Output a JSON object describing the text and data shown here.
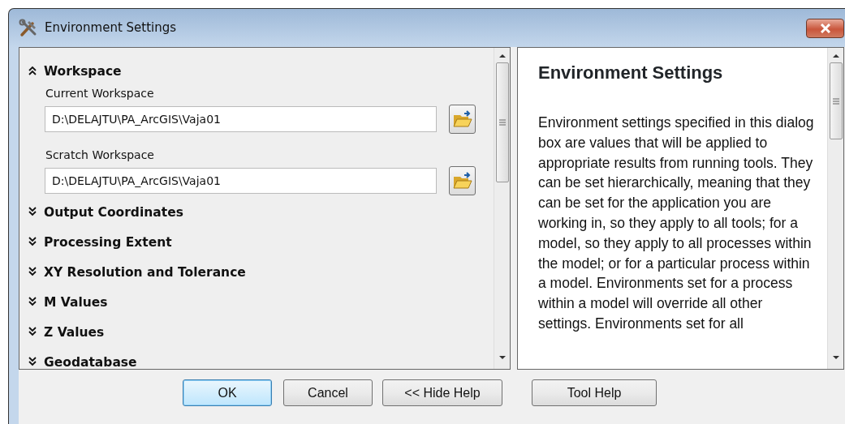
{
  "window": {
    "title": "Environment Settings"
  },
  "sections": [
    {
      "title": "Workspace",
      "expanded": true,
      "fields": [
        {
          "label": "Current Workspace",
          "value": "D:\\DELAJTU\\PA_ArcGIS\\Vaja01"
        },
        {
          "label": "Scratch Workspace",
          "value": "D:\\DELAJTU\\PA_ArcGIS\\Vaja01"
        }
      ]
    },
    {
      "title": "Output Coordinates",
      "expanded": false
    },
    {
      "title": "Processing Extent",
      "expanded": false
    },
    {
      "title": "XY Resolution and Tolerance",
      "expanded": false
    },
    {
      "title": "M Values",
      "expanded": false
    },
    {
      "title": "Z Values",
      "expanded": false
    },
    {
      "title": "Geodatabase",
      "expanded": false
    }
  ],
  "help": {
    "title": "Environment Settings",
    "text": "Environment settings specified in this dialog box are values that will be applied to appropriate results from running tools. They can be set hierarchically, meaning that they can be set for the application you are working in, so they apply to all tools; for a model, so they apply to all processes within the model; or for a particular process within a model. Environments set for a process within a model will override all other settings. Environments set for all"
  },
  "buttons": [
    {
      "label": "OK",
      "default": true
    },
    {
      "label": "Cancel",
      "default": false
    },
    {
      "label": "<< Hide Help",
      "default": false
    },
    {
      "label": "Tool Help",
      "default": false
    }
  ]
}
